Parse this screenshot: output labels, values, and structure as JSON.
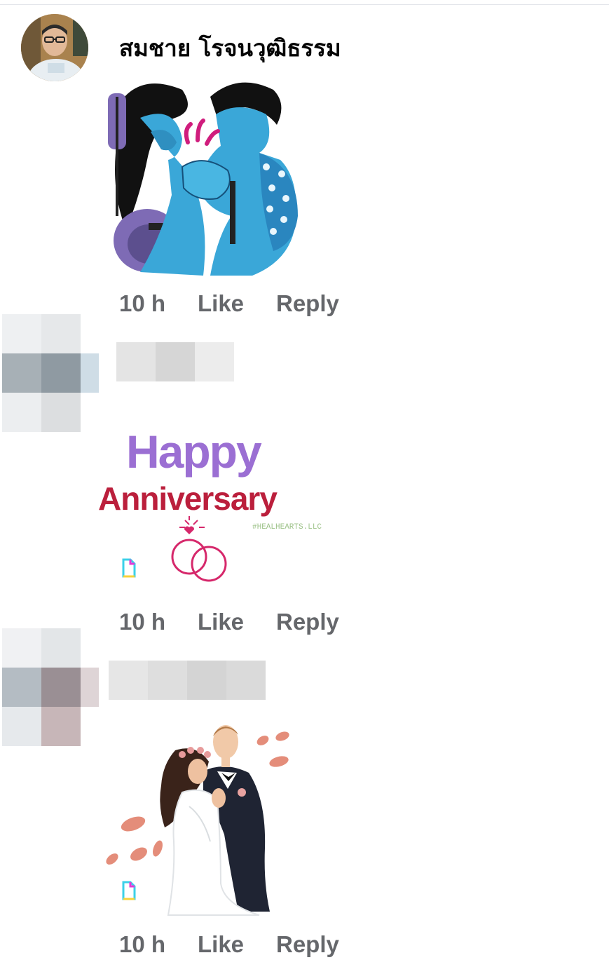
{
  "comment1": {
    "author": "สมชาย โรจนวุฒิธรรม",
    "time": "10 h",
    "like": "Like",
    "reply": "Reply",
    "sticker_icon": "couple-handshake-sticker"
  },
  "comment2": {
    "author": "",
    "sticker": {
      "line1": "Happy",
      "line2": "Anniversary",
      "watermark": "#HEALHEARTS.LLC"
    },
    "time": "10 h",
    "like": "Like",
    "reply": "Reply"
  },
  "comment3": {
    "author": "",
    "sticker_icon": "wedding-couple-sticker",
    "time": "10 h",
    "like": "Like",
    "reply": "Reply"
  },
  "colors": {
    "action_text": "#65676b",
    "name_text": "#050505",
    "happy_purple": "#9b6fd3",
    "anniversary_red": "#bb1f3c",
    "ring_pink": "#d6286b",
    "figure_blue": "#3aa7d8"
  }
}
